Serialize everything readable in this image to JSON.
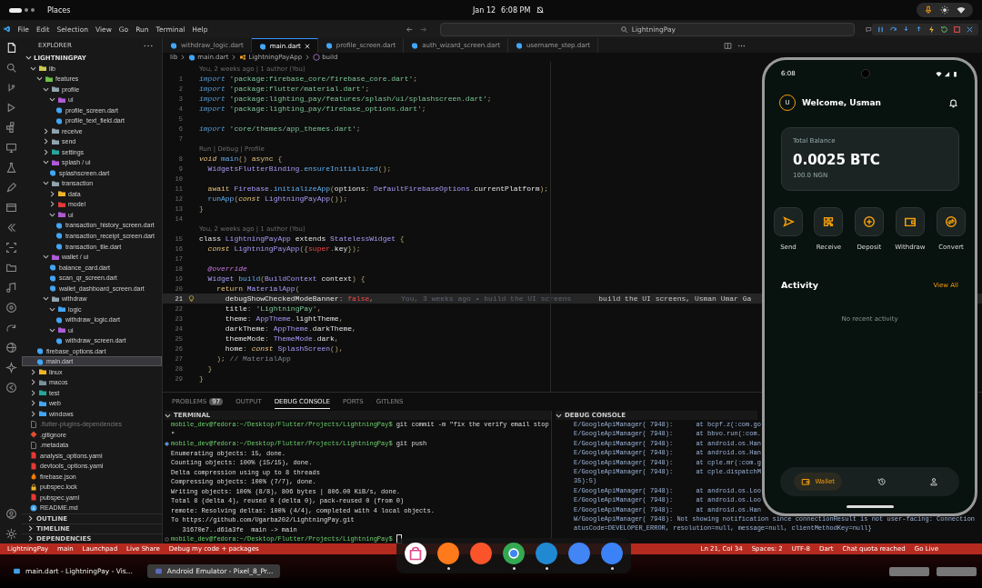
{
  "top_bar": {
    "app": "Places",
    "date": "Jan 12",
    "time": "6:08 PM"
  },
  "menu": [
    "File",
    "Edit",
    "Selection",
    "View",
    "Go",
    "Run",
    "Terminal",
    "Help"
  ],
  "command_center": "LightningPay",
  "explorer": {
    "title": "EXPLORER",
    "project": "LIGHTNINGPAY",
    "items": [
      {
        "name": "lib",
        "kind": "folder",
        "color": "#c9c950",
        "expanded": true,
        "selected": false,
        "dimmed": false,
        "children": [
          {
            "name": "features",
            "kind": "folder",
            "color": "#6cbf4a",
            "expanded": true,
            "selected": false,
            "children": [
              {
                "name": "profile",
                "kind": "folder",
                "color": "#90a4ae",
                "expanded": true,
                "selected": false,
                "children": [
                  {
                    "name": "ui",
                    "kind": "folder",
                    "color": "#b05ad8",
                    "expanded": true,
                    "selected": false,
                    "children": [
                      {
                        "name": "profile_screen.dart",
                        "kind": "dart",
                        "selected": false
                      },
                      {
                        "name": "profile_text_field.dart",
                        "kind": "dart",
                        "selected": false
                      }
                    ]
                  }
                ]
              },
              {
                "name": "receive",
                "kind": "folder",
                "color": "#90a4ae",
                "expanded": false,
                "selected": false
              },
              {
                "name": "send",
                "kind": "folder",
                "color": "#90a4ae",
                "expanded": false,
                "selected": false
              },
              {
                "name": "settings",
                "kind": "folder",
                "color": "#26a69a",
                "expanded": false,
                "selected": false
              },
              {
                "name": "splash / ui",
                "kind": "folder",
                "color": "#b05ad8",
                "expanded": true,
                "selected": false,
                "children": [
                  {
                    "name": "splashscreen.dart",
                    "kind": "dart",
                    "selected": false
                  }
                ]
              },
              {
                "name": "transaction",
                "kind": "folder",
                "color": "#90a4ae",
                "expanded": true,
                "selected": false,
                "children": [
                  {
                    "name": "data",
                    "kind": "folder",
                    "color": "#f0b429",
                    "expanded": false,
                    "selected": false
                  },
                  {
                    "name": "model",
                    "kind": "folder",
                    "color": "#e53935",
                    "expanded": false,
                    "selected": false
                  },
                  {
                    "name": "ui",
                    "kind": "folder",
                    "color": "#b05ad8",
                    "expanded": true,
                    "selected": false,
                    "children": [
                      {
                        "name": "transaction_history_screen.dart",
                        "kind": "dart",
                        "selected": false
                      },
                      {
                        "name": "transaction_receipt_screen.dart",
                        "kind": "dart",
                        "selected": false
                      },
                      {
                        "name": "transaction_tile.dart",
                        "kind": "dart",
                        "selected": false
                      }
                    ]
                  }
                ]
              },
              {
                "name": "wallet / ui",
                "kind": "folder",
                "color": "#b05ad8",
                "expanded": true,
                "selected": false,
                "children": [
                  {
                    "name": "balance_card.dart",
                    "kind": "dart",
                    "selected": false
                  },
                  {
                    "name": "scan_qr_screen.dart",
                    "kind": "dart",
                    "selected": false
                  },
                  {
                    "name": "wallet_dashboard_screen.dart",
                    "kind": "dart",
                    "selected": false
                  }
                ]
              },
              {
                "name": "withdraw",
                "kind": "folder",
                "color": "#90a4ae",
                "expanded": true,
                "selected": false,
                "children": [
                  {
                    "name": "logic",
                    "kind": "folder",
                    "color": "#42a5f5",
                    "expanded": true,
                    "selected": false,
                    "children": [
                      {
                        "name": "withdraw_logic.dart",
                        "kind": "dart",
                        "selected": false
                      }
                    ]
                  },
                  {
                    "name": "ui",
                    "kind": "folder",
                    "color": "#b05ad8",
                    "expanded": true,
                    "selected": false,
                    "children": [
                      {
                        "name": "withdraw_screen.dart",
                        "kind": "dart",
                        "selected": false
                      }
                    ]
                  }
                ]
              }
            ]
          },
          {
            "name": "firebase_options.dart",
            "kind": "dart",
            "selected": false
          },
          {
            "name": "main.dart",
            "kind": "dart",
            "selected": true
          }
        ]
      },
      {
        "name": "linux",
        "kind": "folder",
        "color": "#f0b429",
        "expanded": false,
        "selected": false,
        "dimmed": false
      },
      {
        "name": "macos",
        "kind": "folder",
        "color": "#78909c",
        "expanded": false,
        "selected": false,
        "dimmed": false
      },
      {
        "name": "test",
        "kind": "folder",
        "color": "#26a69a",
        "expanded": false,
        "selected": false,
        "dimmed": false
      },
      {
        "name": "web",
        "kind": "folder",
        "color": "#42a5f5",
        "expanded": false,
        "selected": false,
        "dimmed": false
      },
      {
        "name": "windows",
        "kind": "folder",
        "color": "#42a5f5",
        "expanded": false,
        "selected": false,
        "dimmed": false
      },
      {
        "name": ".flutter-plugins-dependencies",
        "kind": "plain",
        "selected": false,
        "dimmed": true
      },
      {
        "name": ".gitignore",
        "kind": "git",
        "selected": false,
        "dimmed": false
      },
      {
        "name": ".metadata",
        "kind": "plain",
        "selected": false,
        "dimmed": false
      },
      {
        "name": "analysis_options.yaml",
        "kind": "yaml",
        "selected": false,
        "dimmed": false
      },
      {
        "name": "devtools_options.yaml",
        "kind": "yaml",
        "selected": false,
        "dimmed": false
      },
      {
        "name": "firebase.json",
        "kind": "json",
        "selected": false,
        "dimmed": false
      },
      {
        "name": "pubspec.lock",
        "kind": "lock",
        "selected": false,
        "dimmed": false
      },
      {
        "name": "pubspec.yaml",
        "kind": "yaml",
        "selected": false,
        "dimmed": false
      },
      {
        "name": "README.md",
        "kind": "info",
        "selected": false,
        "dimmed": false
      }
    ],
    "sections": [
      "OUTLINE",
      "TIMELINE",
      "DEPENDENCIES"
    ]
  },
  "editor_tabs": [
    {
      "label": "withdraw_logic.dart",
      "selected": false
    },
    {
      "label": "main.dart",
      "selected": true
    },
    {
      "label": "profile_screen.dart",
      "selected": false
    },
    {
      "label": "auth_wizard_screen.dart",
      "selected": false
    },
    {
      "label": "username_step.dart",
      "selected": false
    }
  ],
  "breadcrumb": [
    {
      "text": "lib",
      "kind": "folder"
    },
    {
      "text": "main.dart",
      "kind": "file"
    },
    {
      "text": "LightningPayApp",
      "kind": "class"
    },
    {
      "text": "build",
      "kind": "method"
    }
  ],
  "code": [
    {
      "kind": "lens",
      "tokens": [
        {
          "kind": "lens",
          "text": "You, 2 weeks ago | 1 author (You)"
        }
      ]
    },
    {
      "kind": "code",
      "num": "1",
      "tokens": [
        {
          "kind": "imp",
          "text": "import "
        },
        {
          "kind": "str",
          "text": "'package:firebase_core/firebase_core.dart'"
        },
        {
          "kind": "p",
          "text": ";"
        }
      ]
    },
    {
      "kind": "code",
      "num": "2",
      "tokens": [
        {
          "kind": "imp",
          "text": "import "
        },
        {
          "kind": "str",
          "text": "'package:flutter/material.dart'"
        },
        {
          "kind": "p",
          "text": ";"
        }
      ]
    },
    {
      "kind": "code",
      "num": "3",
      "tokens": [
        {
          "kind": "imp",
          "text": "import "
        },
        {
          "kind": "str",
          "text": "'package:lighting_pay/features/splash/ui/splashscreen.dart'"
        },
        {
          "kind": "p",
          "text": ";"
        }
      ]
    },
    {
      "kind": "code",
      "num": "4",
      "tokens": [
        {
          "kind": "imp",
          "text": "import "
        },
        {
          "kind": "str",
          "text": "'package:lighting_pay/firebase_options.dart'"
        },
        {
          "kind": "p",
          "text": ";"
        }
      ]
    },
    {
      "kind": "code",
      "num": "5"
    },
    {
      "kind": "code",
      "num": "6",
      "tokens": [
        {
          "kind": "imp",
          "text": "import "
        },
        {
          "kind": "str",
          "text": "'core/themes/app_themes.dart'"
        },
        {
          "kind": "p",
          "text": ";"
        }
      ]
    },
    {
      "kind": "code",
      "num": "7"
    },
    {
      "kind": "lens",
      "tokens": [
        {
          "kind": "lens",
          "text": "Run | Debug | Profile"
        }
      ]
    },
    {
      "kind": "code",
      "num": "8",
      "tokens": [
        {
          "kind": "mod",
          "text": "void "
        },
        {
          "kind": "fn",
          "text": "main"
        },
        {
          "kind": "p",
          "text": "() "
        },
        {
          "kind": "ctrl",
          "text": "async "
        },
        {
          "kind": "p",
          "text": "{"
        }
      ]
    },
    {
      "kind": "code",
      "num": "9",
      "tokens": [
        {
          "kind": "type",
          "text": "  WidgetsFlutterBinding"
        },
        {
          "kind": "p",
          "text": "."
        },
        {
          "kind": "fn",
          "text": "ensureInitialized"
        },
        {
          "kind": "p",
          "text": "();"
        }
      ]
    },
    {
      "kind": "code",
      "num": "10"
    },
    {
      "kind": "code",
      "num": "11",
      "tokens": [
        {
          "kind": "ctrl",
          "text": "  await "
        },
        {
          "kind": "type",
          "text": "Firebase"
        },
        {
          "kind": "p",
          "text": "."
        },
        {
          "kind": "fn",
          "text": "initializeApp"
        },
        {
          "kind": "p",
          "text": "("
        },
        {
          "kind": "plain",
          "text": "options"
        },
        {
          "kind": "p",
          "text": ": "
        },
        {
          "kind": "type",
          "text": "DefaultFirebaseOptions"
        },
        {
          "kind": "p",
          "text": "."
        },
        {
          "kind": "plain",
          "text": "currentPlatform"
        },
        {
          "kind": "p",
          "text": ");"
        }
      ]
    },
    {
      "kind": "code",
      "num": "12",
      "tokens": [
        {
          "kind": "fn",
          "text": "  runApp"
        },
        {
          "kind": "p",
          "text": "("
        },
        {
          "kind": "mod",
          "text": "const "
        },
        {
          "kind": "type",
          "text": "LightningPayApp"
        },
        {
          "kind": "p",
          "text": "());"
        }
      ]
    },
    {
      "kind": "code",
      "num": "13",
      "tokens": [
        {
          "kind": "p",
          "text": "}"
        }
      ]
    },
    {
      "kind": "code",
      "num": "14"
    },
    {
      "kind": "lens",
      "tokens": [
        {
          "kind": "lens",
          "text": "You, 2 weeks ago | 1 author (You)"
        }
      ]
    },
    {
      "kind": "code",
      "num": "15",
      "tokens": [
        {
          "kind": "plain",
          "text": "class "
        },
        {
          "kind": "type",
          "text": "LightningPayApp"
        },
        {
          "kind": "plain",
          "text": " extends "
        },
        {
          "kind": "type",
          "text": "StatelessWidget"
        },
        {
          "kind": "p",
          "text": " {"
        }
      ]
    },
    {
      "kind": "code",
      "num": "16",
      "tokens": [
        {
          "kind": "mod",
          "text": "  const "
        },
        {
          "kind": "type",
          "text": "LightningPayApp"
        },
        {
          "kind": "p",
          "text": "({"
        },
        {
          "kind": "bool",
          "text": "super"
        },
        {
          "kind": "p",
          "text": "."
        },
        {
          "kind": "plain",
          "text": "key"
        },
        {
          "kind": "p",
          "text": "});"
        }
      ]
    },
    {
      "kind": "code",
      "num": "17"
    },
    {
      "kind": "code",
      "num": "18",
      "tokens": [
        {
          "kind": "anno",
          "text": "  @override"
        }
      ]
    },
    {
      "kind": "code",
      "num": "19",
      "tokens": [
        {
          "kind": "type",
          "text": "  Widget "
        },
        {
          "kind": "fn",
          "text": "build"
        },
        {
          "kind": "p",
          "text": "("
        },
        {
          "kind": "type",
          "text": "BuildContext "
        },
        {
          "kind": "plain",
          "text": "context"
        },
        {
          "kind": "p",
          "text": ") {"
        }
      ]
    },
    {
      "kind": "code",
      "num": "20",
      "tokens": [
        {
          "kind": "ctrl",
          "text": "    return "
        },
        {
          "kind": "type",
          "text": "MaterialApp"
        },
        {
          "kind": "p",
          "text": "("
        }
      ]
    },
    {
      "kind": "current",
      "num": "21",
      "tokens": [
        {
          "kind": "plain",
          "text": "      debugShowCheckedModeBanner"
        },
        {
          "kind": "p",
          "text": ": "
        },
        {
          "kind": "bool",
          "text": "false"
        },
        {
          "kind": "p",
          "text": ","
        },
        {
          "kind": "blame",
          "text": "You, 3 weeks ago • build the UI screens"
        },
        {
          "kind": "hover",
          "text": "build the UI screens, Usman Umar Ga"
        }
      ]
    },
    {
      "kind": "code",
      "num": "22",
      "tokens": [
        {
          "kind": "plain",
          "text": "      title"
        },
        {
          "kind": "p",
          "text": ": "
        },
        {
          "kind": "str",
          "text": "'LightningPay'"
        },
        {
          "kind": "p",
          "text": ","
        }
      ]
    },
    {
      "kind": "code",
      "num": "23",
      "tokens": [
        {
          "kind": "plain",
          "text": "      theme"
        },
        {
          "kind": "p",
          "text": ": "
        },
        {
          "kind": "type",
          "text": "AppTheme"
        },
        {
          "kind": "p",
          "text": "."
        },
        {
          "kind": "plain",
          "text": "lightTheme"
        },
        {
          "kind": "p",
          "text": ","
        }
      ]
    },
    {
      "kind": "code",
      "num": "24",
      "tokens": [
        {
          "kind": "plain",
          "text": "      darkTheme"
        },
        {
          "kind": "p",
          "text": ": "
        },
        {
          "kind": "type",
          "text": "AppTheme"
        },
        {
          "kind": "p",
          "text": "."
        },
        {
          "kind": "plain",
          "text": "darkTheme"
        },
        {
          "kind": "p",
          "text": ","
        }
      ]
    },
    {
      "kind": "code",
      "num": "25",
      "tokens": [
        {
          "kind": "plain",
          "text": "      themeMode"
        },
        {
          "kind": "p",
          "text": ": "
        },
        {
          "kind": "type",
          "text": "ThemeMode"
        },
        {
          "kind": "p",
          "text": "."
        },
        {
          "kind": "plain",
          "text": "dark"
        },
        {
          "kind": "p",
          "text": ","
        }
      ]
    },
    {
      "kind": "code",
      "num": "26",
      "tokens": [
        {
          "kind": "plain",
          "text": "      home"
        },
        {
          "kind": "p",
          "text": ": "
        },
        {
          "kind": "mod",
          "text": "const "
        },
        {
          "kind": "type",
          "text": "SplashScreen"
        },
        {
          "kind": "p",
          "text": "(),"
        }
      ]
    },
    {
      "kind": "code",
      "num": "27",
      "tokens": [
        {
          "kind": "p",
          "text": "    ); "
        },
        {
          "kind": "comment",
          "text": "// MaterialApp"
        }
      ]
    },
    {
      "kind": "code",
      "num": "28",
      "tokens": [
        {
          "kind": "p",
          "text": "  }"
        }
      ]
    },
    {
      "kind": "code",
      "num": "29",
      "tokens": [
        {
          "kind": "p",
          "text": "}"
        }
      ]
    }
  ],
  "panel": {
    "tabs": [
      {
        "label": "PROBLEMS",
        "badge": "97",
        "selected": false
      },
      {
        "label": "OUTPUT",
        "selected": false
      },
      {
        "label": "DEBUG CONSOLE",
        "selected": true
      },
      {
        "label": "PORTS",
        "selected": false
      },
      {
        "label": "GITLENS",
        "selected": false
      }
    ],
    "terminal": {
      "title": "TERMINAL",
      "lines": [
        {
          "kind": "prompt",
          "prompt": "mobile_dev@fedora:~/Desktop/Flutter/Projects/LightningPay$",
          "text": "git commit -m \"fix the verify email stop"
        },
        {
          "kind": "output",
          "text": "\""
        },
        {
          "kind": "done",
          "prompt": "mobile_dev@fedora:~/Desktop/Flutter/Projects/LightningPay$",
          "text": "git push"
        },
        {
          "kind": "output",
          "text": "Enumerating objects: 15, done."
        },
        {
          "kind": "output",
          "text": "Counting objects: 100% (15/15), done."
        },
        {
          "kind": "output",
          "text": "Delta compression using up to 8 threads"
        },
        {
          "kind": "output",
          "text": "Compressing objects: 100% (7/7), done."
        },
        {
          "kind": "output",
          "text": "Writing objects: 100% (8/8), 806 bytes | 806.00 KiB/s, done."
        },
        {
          "kind": "output",
          "text": "Total 8 (delta 4), reused 0 (delta 0), pack-reused 0 (from 0)"
        },
        {
          "kind": "output",
          "text": "remote: Resolving deltas: 100% (4/4), completed with 4 local objects."
        },
        {
          "kind": "output",
          "text": "To https://github.com/Ugarba202/LightningPay.git"
        },
        {
          "kind": "output",
          "text": "   31670e7..d61a3fe  main -> main"
        },
        {
          "kind": "active",
          "prompt": "mobile_dev@fedora:~/Desktop/Flutter/Projects/LightningPay$"
        }
      ]
    },
    "debug_console": {
      "title": "DEBUG CONSOLE",
      "lines": [
        "E/GoogleApiManager( 7948):      at bcpf.z(:com.go",
        "E/GoogleApiManager( 7948):      at bbvo.run(:com.",
        "E/GoogleApiManager( 7948):      at android.os.Han",
        "E/GoogleApiManager( 7948):      at android.os.Han",
        "E/GoogleApiManager( 7948):      at cple.mr(:com.g",
        "E/GoogleApiManager( 7948):      at cple.dispatchM",
        "35):5)",
        "E/GoogleApiManager( 7948):      at android.os.Loo",
        "E/GoogleApiManager( 7948):      at android.os.Loo",
        "E/GoogleApiManager( 7948):      at android.os.Han",
        "W/GoogleApiManager( 7948): Not showing notification since connectionResult is not user-facing: Connection",
        "atusCode=DEVELOPER_ERROR, resolution=null, message=null, clientMethodKey=null}"
      ]
    }
  },
  "status_bar": {
    "left": [
      "LightningPay",
      "main",
      "Launchpad",
      "Live Share",
      "Debug my code + packages"
    ],
    "right": [
      "Ln 21, Col 34",
      "Spaces: 2",
      "UTF-8",
      "Dart",
      "Chat quota reached",
      "Go Live"
    ]
  },
  "taskbar": [
    {
      "label": "main.dart - LightningPay - Vis...",
      "selected": false
    },
    {
      "label": "Android Emulator - Pixel_8_Pr...",
      "selected": true
    }
  ],
  "phone": {
    "time": "6:08",
    "avatar": "U",
    "greeting": "Welcome, Usman",
    "balance": {
      "label": "Total Balance",
      "amount": "0.0025 BTC",
      "fiat": "100.0 NGN"
    },
    "actions": [
      {
        "kind": "send",
        "label": "Send"
      },
      {
        "kind": "receive",
        "label": "Receive"
      },
      {
        "kind": "deposit",
        "label": "Deposit"
      },
      {
        "kind": "withdraw",
        "label": "Withdraw"
      },
      {
        "kind": "convert",
        "label": "Convert"
      }
    ],
    "activity": {
      "title": "Activity",
      "link": "View All",
      "empty": "No recent activity"
    },
    "nav": [
      {
        "kind": "wallet",
        "label": "Wallet",
        "selected": true
      },
      {
        "kind": "history",
        "selected": false
      },
      {
        "kind": "profile",
        "selected": false
      }
    ]
  }
}
